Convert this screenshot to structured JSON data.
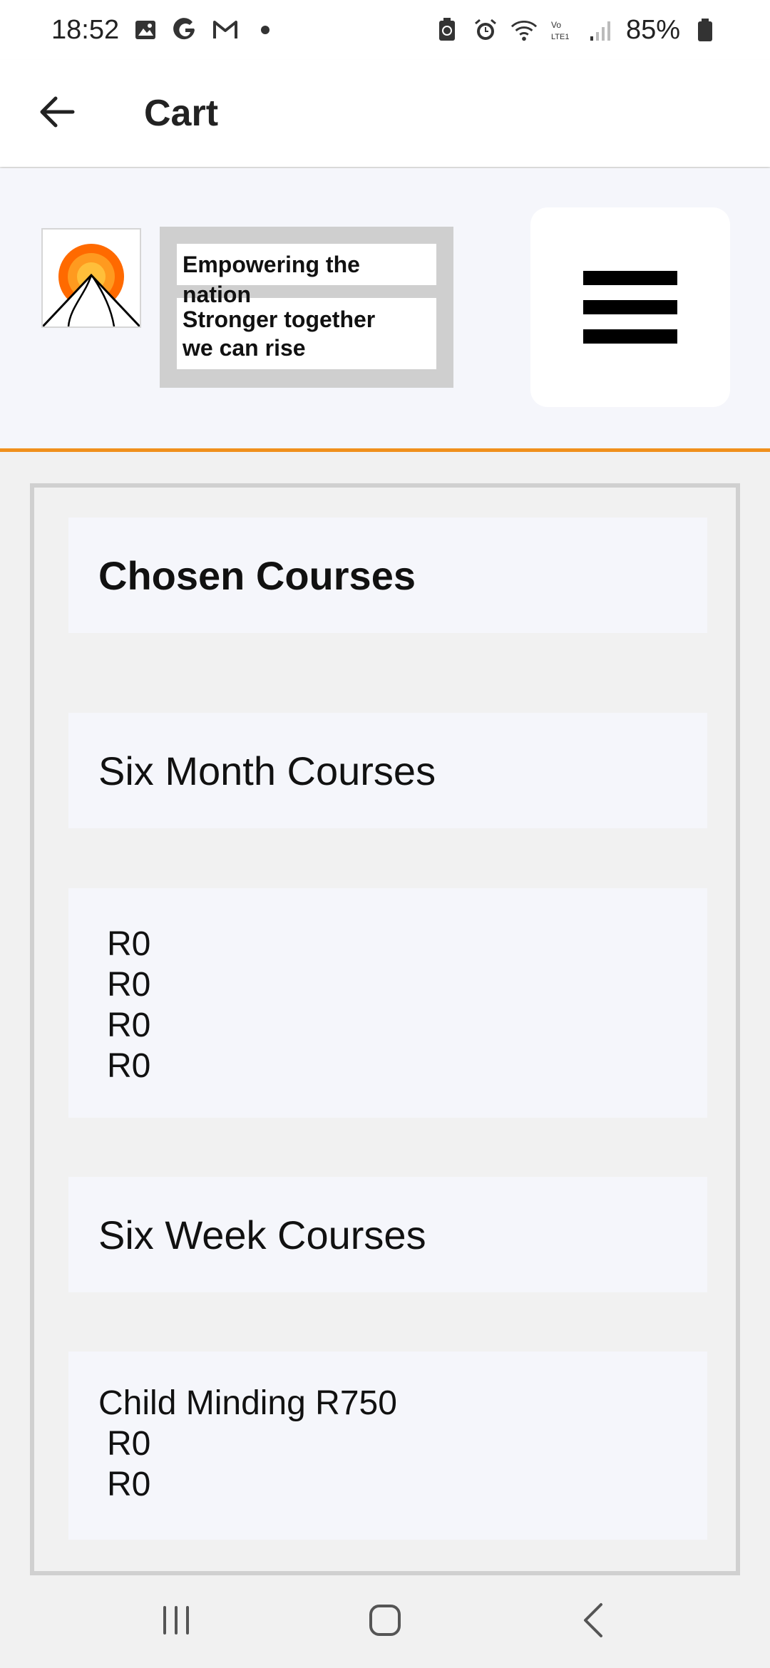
{
  "status_bar": {
    "time": "18:52",
    "left_icons": [
      "gallery-icon",
      "google-icon",
      "gmail-icon",
      "dot-icon"
    ],
    "right_icons": [
      "battery-saver-icon",
      "alarm-icon",
      "wifi-icon",
      "volte-icon",
      "signal-icon"
    ],
    "battery": "85%"
  },
  "app_bar": {
    "title": "Cart",
    "back_icon": "arrow-left-icon"
  },
  "banner": {
    "tagline_1": "Empowering the nation",
    "tagline_2": "Stronger together\nwe can rise",
    "accent_color": "#f0901c",
    "menu_icon": "hamburger-menu-icon"
  },
  "cart": {
    "heading": "Chosen Courses",
    "six_month": {
      "title": "Six Month Courses",
      "items": [
        "R0",
        "R0",
        "R0",
        "R0"
      ]
    },
    "six_week": {
      "title": "Six Week Courses",
      "items": [
        "Child Minding R750",
        "R0",
        "R0"
      ]
    }
  },
  "nav_bar": {
    "icons": [
      "recent-apps-icon",
      "home-icon",
      "back-icon"
    ]
  }
}
